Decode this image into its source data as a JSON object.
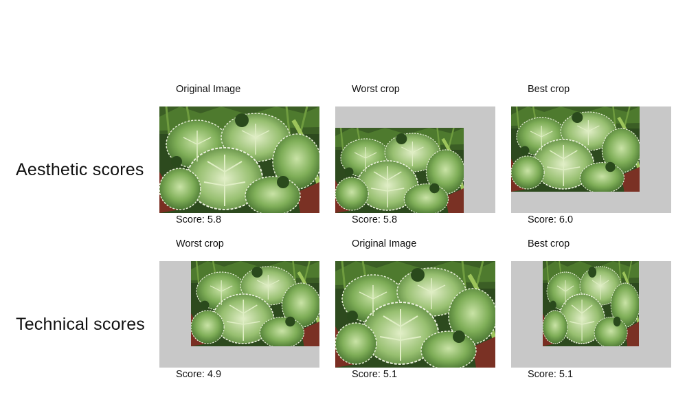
{
  "rows": [
    {
      "label": "Aesthetic scores",
      "cells": [
        {
          "title": "Original Image",
          "score": "Score: 5.8",
          "crop": "full"
        },
        {
          "title": "Worst crop",
          "score": "Score: 5.8",
          "crop": "bottom-left"
        },
        {
          "title": "Best crop",
          "score": "Score: 6.0",
          "crop": "top-left"
        }
      ]
    },
    {
      "label": "Technical scores",
      "cells": [
        {
          "title": "Worst crop",
          "score": "Score: 4.9",
          "crop": "top-right"
        },
        {
          "title": "Original Image",
          "score": "Score: 5.1",
          "crop": "full"
        },
        {
          "title": "Best crop",
          "score": "Score: 5.1",
          "crop": "top-center"
        }
      ]
    }
  ],
  "colors": {
    "padding": "#c8c8c8",
    "background": "#ffffff"
  }
}
